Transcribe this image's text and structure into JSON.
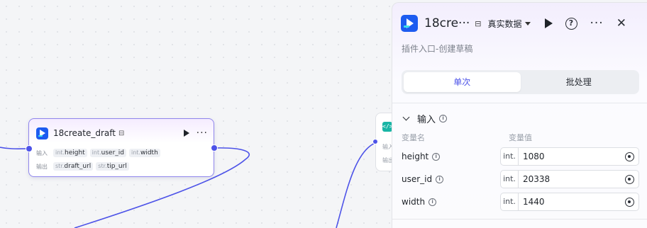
{
  "node": {
    "title": "18create_draft",
    "input_label": "输入",
    "output_label": "输出",
    "inputs": [
      {
        "type": "int.",
        "name": "height"
      },
      {
        "type": "int.",
        "name": "user_id"
      },
      {
        "type": "int.",
        "name": "width"
      }
    ],
    "outputs": [
      {
        "type": "str.",
        "name": "draft_url"
      },
      {
        "type": "str.",
        "name": "tip_url"
      }
    ],
    "icons": [
      "plugin-logo-icon",
      "node-side-icon",
      "play-icon",
      "more-icon"
    ]
  },
  "node2": {
    "icon_text": "</>",
    "input_label": "输入",
    "output_label": "输出"
  },
  "panel": {
    "title": "18cre···",
    "mode_label": "真实数据",
    "subtitle": "插件入口-创建草稿",
    "tabs": [
      "单次",
      "批处理"
    ],
    "active_tab": "单次",
    "section_title": "输入",
    "col_name": "变量名",
    "col_value": "变量值",
    "variables": [
      {
        "name": "height",
        "type": "int.",
        "value": "1080"
      },
      {
        "name": "user_id",
        "type": "int.",
        "value": "20338"
      },
      {
        "name": "width",
        "type": "int.",
        "value": "1440"
      }
    ]
  },
  "colors": {
    "accent": "#4d53e8",
    "logo": "#1d5cf0",
    "code_node": "#19b5a5",
    "edge": "#4d53e8"
  }
}
